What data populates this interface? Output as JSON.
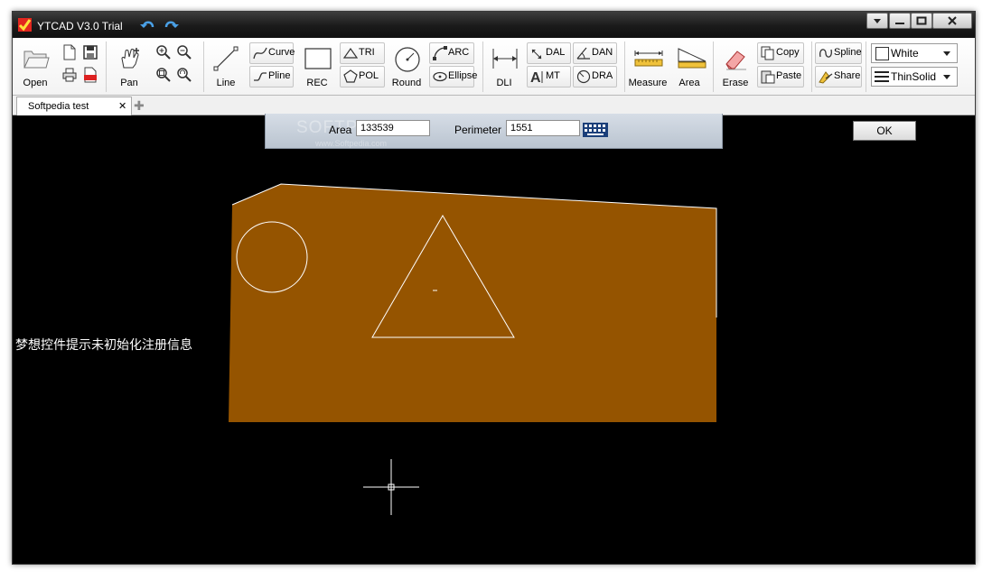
{
  "window": {
    "title": "YTCAD V3.0 Trial"
  },
  "toolbar": {
    "open": "Open",
    "pan": "Pan",
    "line": "Line",
    "curve": "Curve",
    "pline": "Pline",
    "rec": "REC",
    "tri": "TRI",
    "pol": "POL",
    "round": "Round",
    "arc": "ARC",
    "ellipse": "Ellipse",
    "dli": "DLI",
    "dal": "DAL",
    "dan": "DAN",
    "mt": "MT",
    "dra": "DRA",
    "measure": "Measure",
    "area": "Area",
    "erase": "Erase",
    "copy": "Copy",
    "paste": "Paste",
    "spline": "Spline",
    "share": "Share",
    "color": "White",
    "linetype": "ThinSolid"
  },
  "tabs": [
    {
      "label": "Softpedia test"
    }
  ],
  "measure_bar": {
    "area_label": "Area",
    "area_value": "133539",
    "perimeter_label": "Perimeter",
    "perimeter_value": "1551",
    "ok": "OK"
  },
  "watermark": {
    "brand": "SOFTPEDIA",
    "url": "www.Softpedia.com"
  },
  "canvas": {
    "status_message": "梦想控件提示未初始化注册信息",
    "fill_color": "#955400",
    "line_color": "#ffffff",
    "background": "#000000"
  }
}
